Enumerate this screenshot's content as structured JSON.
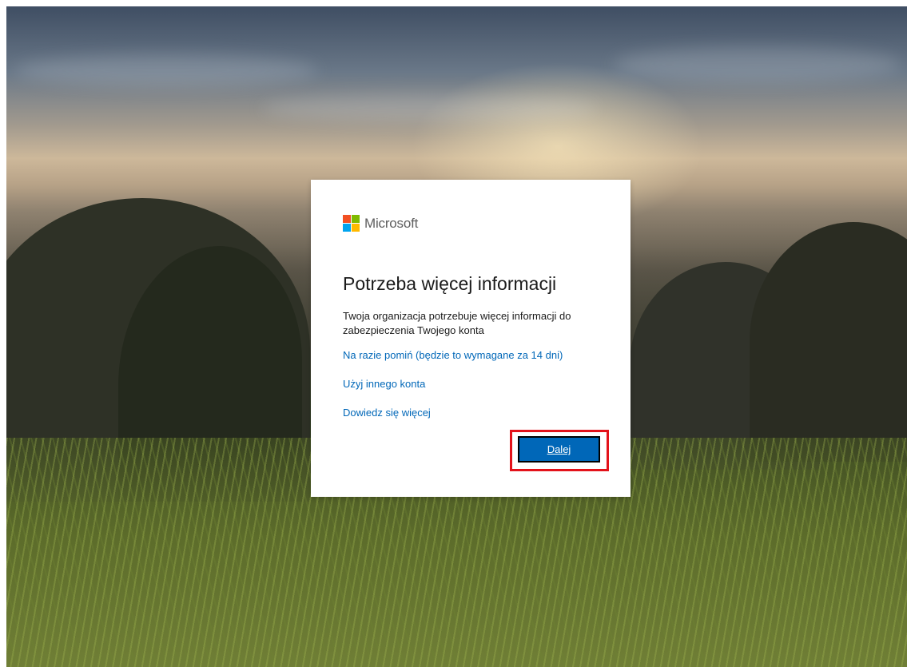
{
  "brand": {
    "name": "Microsoft",
    "logo_colors": [
      "#f25022",
      "#7fba00",
      "#00a4ef",
      "#ffb900"
    ]
  },
  "dialog": {
    "title": "Potrzeba więcej informacji",
    "description": "Twoja organizacja potrzebuje więcej informacji do zabezpieczenia Twojego konta",
    "skip_link": "Na razie pomiń (będzie to wymagane za 14 dni)",
    "other_account_link": "Użyj innego konta",
    "learn_more_link": "Dowiedz się więcej",
    "next_button": "Dalej"
  },
  "colors": {
    "accent": "#0067b8",
    "highlight": "#e3121a"
  }
}
